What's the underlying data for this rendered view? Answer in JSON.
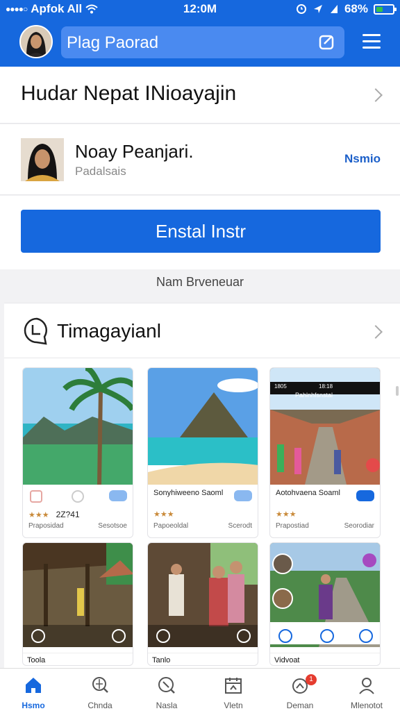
{
  "status_bar": {
    "carrier": "Apfok All",
    "time": "12:0M",
    "battery": "68%"
  },
  "header": {
    "search_text": "Plag Paorad",
    "avatar": "user-avatar",
    "menu_icon": "hamburger-icon"
  },
  "title_row": {
    "title": "Hudar Nepat INioayajin"
  },
  "profile": {
    "name": "Noay Peanjari.",
    "subtitle": "Padalsais",
    "action": "Nsmio"
  },
  "install_button": "Enstal Instr",
  "section_label": "Nam Brveneuar",
  "gallery": {
    "title": "Timagayianl",
    "tiles": [
      {
        "caption": "",
        "rating_text": "2Z?41",
        "foot_left": "Praposidad",
        "foot_right": "Sesotsoe"
      },
      {
        "caption": "Sonyhiweeno Saoml",
        "rating_text": "",
        "foot_left": "Papoeoldal",
        "foot_right": "Scerodt"
      },
      {
        "caption": "Aotohvaena Soaml",
        "rating_text": "",
        "foot_left": "Prapostiad",
        "foot_right": "Seorodiar"
      }
    ],
    "tiles2": [
      {
        "label": "Toola"
      },
      {
        "label": "Tanlo"
      },
      {
        "label": "Vidvoat"
      }
    ],
    "screenshot_inset": {
      "app_name": "Pahlnhfsnstal",
      "time": "1805",
      "time_right": "18:18"
    }
  },
  "tabs": [
    {
      "label": "Hsmo",
      "icon": "home-icon"
    },
    {
      "label": "Chnda",
      "icon": "search-globe-icon"
    },
    {
      "label": "Nasla",
      "icon": "compass-icon"
    },
    {
      "label": "Vletn",
      "icon": "calendar-icon"
    },
    {
      "label": "Deman",
      "icon": "notifications-icon",
      "badge": "1"
    },
    {
      "label": "Mlenotot",
      "icon": "profile-icon"
    }
  ],
  "colors": {
    "primary": "#1668de",
    "search_bg": "#4a8af0",
    "link": "#1b5fc9"
  }
}
